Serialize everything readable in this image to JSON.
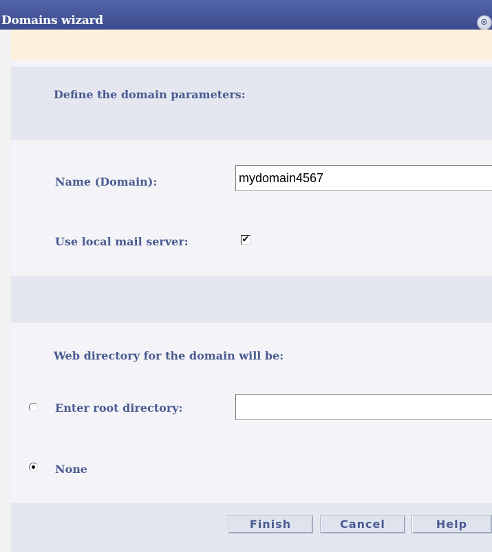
{
  "window": {
    "title": "Domains wizard",
    "close_glyph": "⊗"
  },
  "params_section": {
    "heading": "Define the domain parameters:"
  },
  "form": {
    "name_label": "Name (Domain):",
    "name_value": "mydomain4567",
    "mail_label": "Use local mail server:",
    "mail_checked": true,
    "mail_check_glyph": "✔"
  },
  "web_directory": {
    "heading": "Web directory for the domain will be:",
    "root_label": "Enter root directory:",
    "root_value": "",
    "none_label": "None",
    "selected_option": "none"
  },
  "footer": {
    "finish_label": "Finish",
    "cancel_label": "Cancel",
    "help_label": "Help"
  }
}
